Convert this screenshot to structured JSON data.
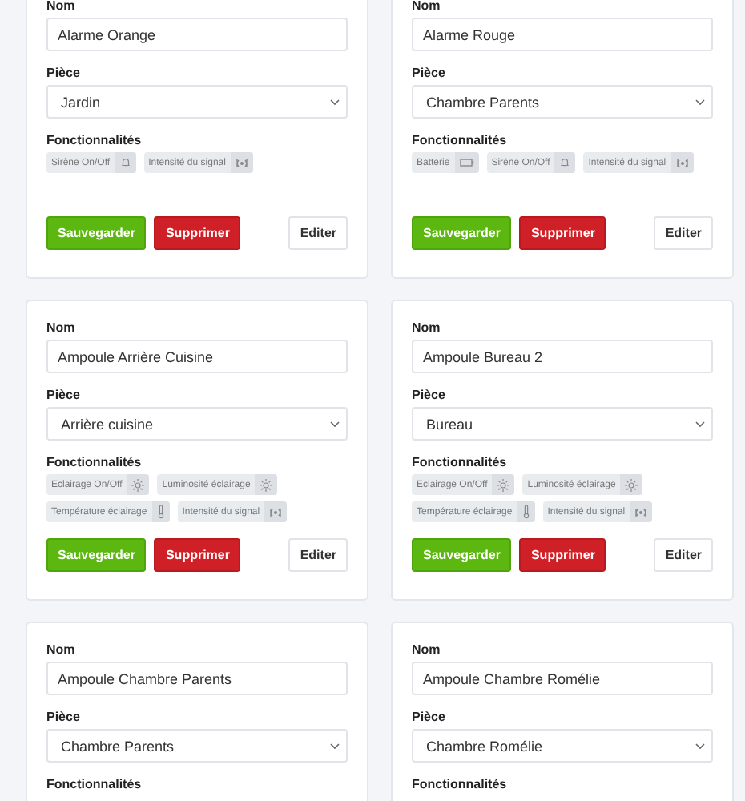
{
  "devices": [
    {
      "name_label": "Nom",
      "name": "Alarme Orange",
      "room_label": "Pièce",
      "room": "Jardin",
      "features_label": "Fonctionnalités",
      "features": [
        {
          "label": "Sirène On/Off",
          "kind": "bell"
        },
        {
          "label": "Intensité du signal",
          "kind": "signal"
        }
      ],
      "buttons": [
        "Sauvegarder",
        "Supprimer",
        "Editer"
      ]
    },
    {
      "name_label": "Nom",
      "name": "Alarme Rouge",
      "room_label": "Pièce",
      "room": "Chambre Parents",
      "features_label": "Fonctionnalités",
      "features": [
        {
          "label": "Batterie",
          "kind": "battery"
        },
        {
          "label": "Sirène On/Off",
          "kind": "bell"
        },
        {
          "label": "Intensité du signal",
          "kind": "signal"
        }
      ],
      "buttons": [
        "Sauvegarder",
        "Supprimer",
        "Editer"
      ]
    },
    {
      "name_label": "Nom",
      "name": "Ampoule Arrière Cuisine",
      "room_label": "Pièce",
      "room": "Arrière cuisine",
      "features_label": "Fonctionnalités",
      "features": [
        {
          "label": "Eclairage On/Off",
          "kind": "sun"
        },
        {
          "label": "Luminosité éclairage",
          "kind": "sun"
        },
        {
          "label": "Température éclairage",
          "kind": "thermometer"
        },
        {
          "label": "Intensité du signal",
          "kind": "signal"
        }
      ],
      "buttons": [
        "Sauvegarder",
        "Supprimer",
        "Editer"
      ]
    },
    {
      "name_label": "Nom",
      "name": "Ampoule Bureau 2",
      "room_label": "Pièce",
      "room": "Bureau",
      "features_label": "Fonctionnalités",
      "features": [
        {
          "label": "Eclairage On/Off",
          "kind": "sun"
        },
        {
          "label": "Luminosité éclairage",
          "kind": "sun"
        },
        {
          "label": "Température éclairage",
          "kind": "thermometer"
        },
        {
          "label": "Intensité du signal",
          "kind": "signal"
        }
      ],
      "buttons": [
        "Sauvegarder",
        "Supprimer",
        "Editer"
      ]
    },
    {
      "name_label": "Nom",
      "name": "Ampoule Chambre Parents",
      "room_label": "Pièce",
      "room": "Chambre Parents",
      "features_label": "Fonctionnalités"
    },
    {
      "name_label": "Nom",
      "name": "Ampoule Chambre Romélie",
      "room_label": "Pièce",
      "room": "Chambre Romélie",
      "features_label": "Fonctionnalités"
    }
  ]
}
